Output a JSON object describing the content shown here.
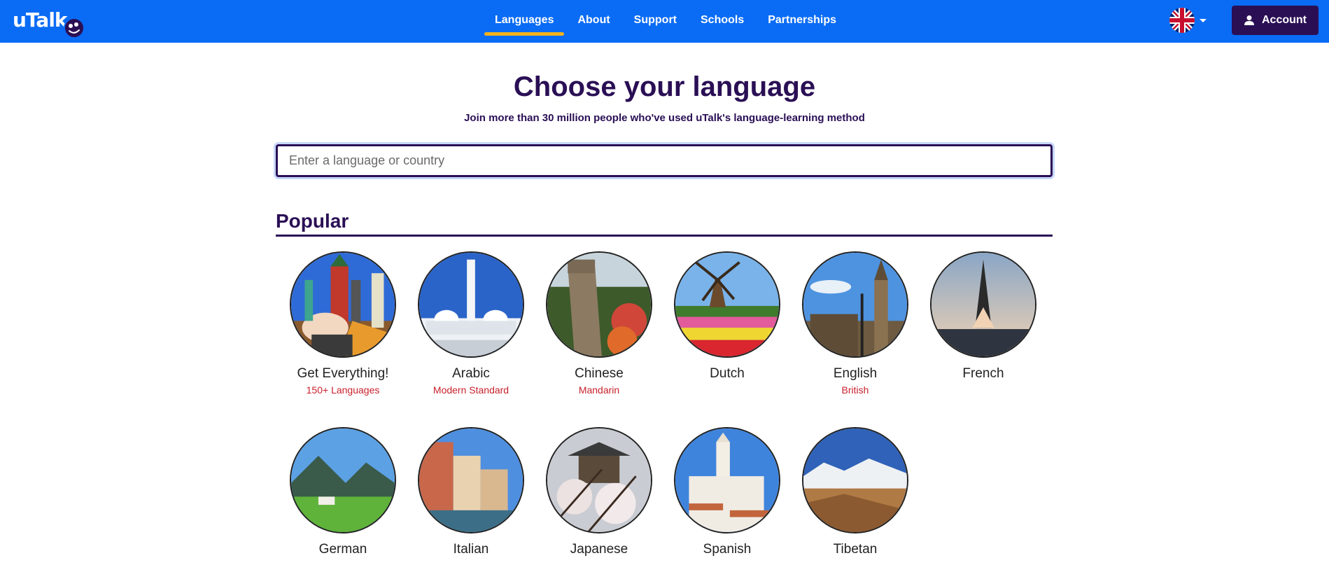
{
  "header": {
    "logo_text": "uTalk",
    "nav": [
      {
        "label": "Languages",
        "active": true
      },
      {
        "label": "About"
      },
      {
        "label": "Support"
      },
      {
        "label": "Schools"
      },
      {
        "label": "Partnerships"
      }
    ],
    "language_flag_icon": "uk-flag-icon",
    "account_label": "Account",
    "colors": {
      "bar": "#0a6cf5",
      "account": "#2a0f55",
      "active_underline": "#f6b31b"
    }
  },
  "hero": {
    "title": "Choose your language",
    "subtitle": "Join more than 30 million people who've used uTalk's language-learning method",
    "search_placeholder": "Enter a language or country"
  },
  "popular": {
    "heading": "Popular",
    "languages": [
      {
        "name": "Get Everything!",
        "variant": "150+ Languages"
      },
      {
        "name": "Arabic",
        "variant": "Modern Standard"
      },
      {
        "name": "Chinese",
        "variant": "Mandarin"
      },
      {
        "name": "Dutch",
        "variant": ""
      },
      {
        "name": "English",
        "variant": "British"
      },
      {
        "name": "French",
        "variant": ""
      },
      {
        "name": "German",
        "variant": ""
      },
      {
        "name": "Italian",
        "variant": ""
      },
      {
        "name": "Japanese",
        "variant": ""
      },
      {
        "name": "Spanish",
        "variant": ""
      },
      {
        "name": "Tibetan",
        "variant": ""
      }
    ]
  }
}
